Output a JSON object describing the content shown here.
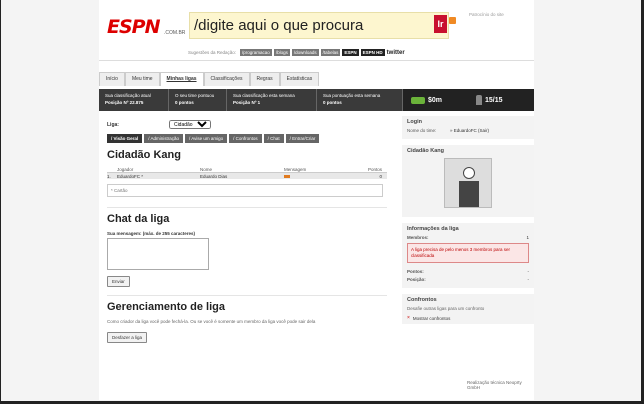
{
  "header": {
    "logo_text": "ESPN",
    "logo_suffix": ".COM.BR",
    "search_value": "/digite aqui o que procura",
    "search_button": "Ir",
    "sponsor_label": "Patrocínio do site",
    "suggestions_label": "Sugestões da Redação:",
    "suggestions": [
      "/programacao",
      "/blogs",
      "/downloads",
      "/tabelas"
    ],
    "brand_tags": [
      "ESPN",
      "ESPN HD"
    ],
    "twitter": "twitter"
  },
  "tabs": [
    "Início",
    "Meu time",
    "Minhas ligas",
    "Classificações",
    "Regras",
    "Estatísticas"
  ],
  "stats": {
    "items": [
      {
        "label": "Sua classificação atual",
        "value": "Posição Nº 22.875"
      },
      {
        "label": "O seu time pontuou",
        "value": "0 pontos"
      },
      {
        "label": "Sua classificação esta semana",
        "value": "Posição Nº 1"
      },
      {
        "label": "Sua pontuação esta semana",
        "value": "0 pontos"
      }
    ],
    "money": "$0m",
    "players": "15/15"
  },
  "league": {
    "label": "Liga:",
    "selected": "Cidadão Kang",
    "subnav": [
      "/ Visão Geral",
      "/ Administração",
      "/ Avise um amigo",
      "/ Confrontos",
      "/ Chat",
      "/ Entrar/Criar"
    ],
    "title": "Cidadão Kang",
    "table": {
      "headers": [
        "",
        "Jogador",
        "Nome",
        "Mensagem",
        "Pontos"
      ],
      "rows": [
        [
          "1.",
          "EduardoFC *",
          "Eduardo Dias",
          "",
          "0"
        ]
      ]
    },
    "caption_placeholder": "* Cartão"
  },
  "chat": {
    "title": "Chat da liga",
    "label": "Sua mensagem: (máx. de 255 caracteres)",
    "send_button": "Enviar"
  },
  "manage": {
    "title": "Gerenciamento de liga",
    "text": "Como criador da liga você pode fechá-la. Ou se você é somente um membro da liga você pode sair dela",
    "button": "Desfazer a liga"
  },
  "login_box": {
    "title": "Login",
    "key": "Nome do time:",
    "value": "» EduardoFC (Sair)"
  },
  "profile_box": {
    "title": "Cidadão Kang"
  },
  "league_info": {
    "title": "Informações da liga",
    "members_label": "Membros:",
    "members_value": "1",
    "alert": "A liga precisa de pelo menos 3 membros para ser classificada",
    "points_label": "Pontos:",
    "points_value": "-",
    "position_label": "Posição:",
    "position_value": "-"
  },
  "confrontos": {
    "title": "Confrontos",
    "text": "Desafie outras ligas para um confronto",
    "link": "Mostrar confrontos"
  },
  "footer": "Realização técnica Neoprty GmbH",
  "colors": {
    "accent": "#c8102e",
    "money": "#6bb33a",
    "alert_bg": "#fbe6e6"
  }
}
